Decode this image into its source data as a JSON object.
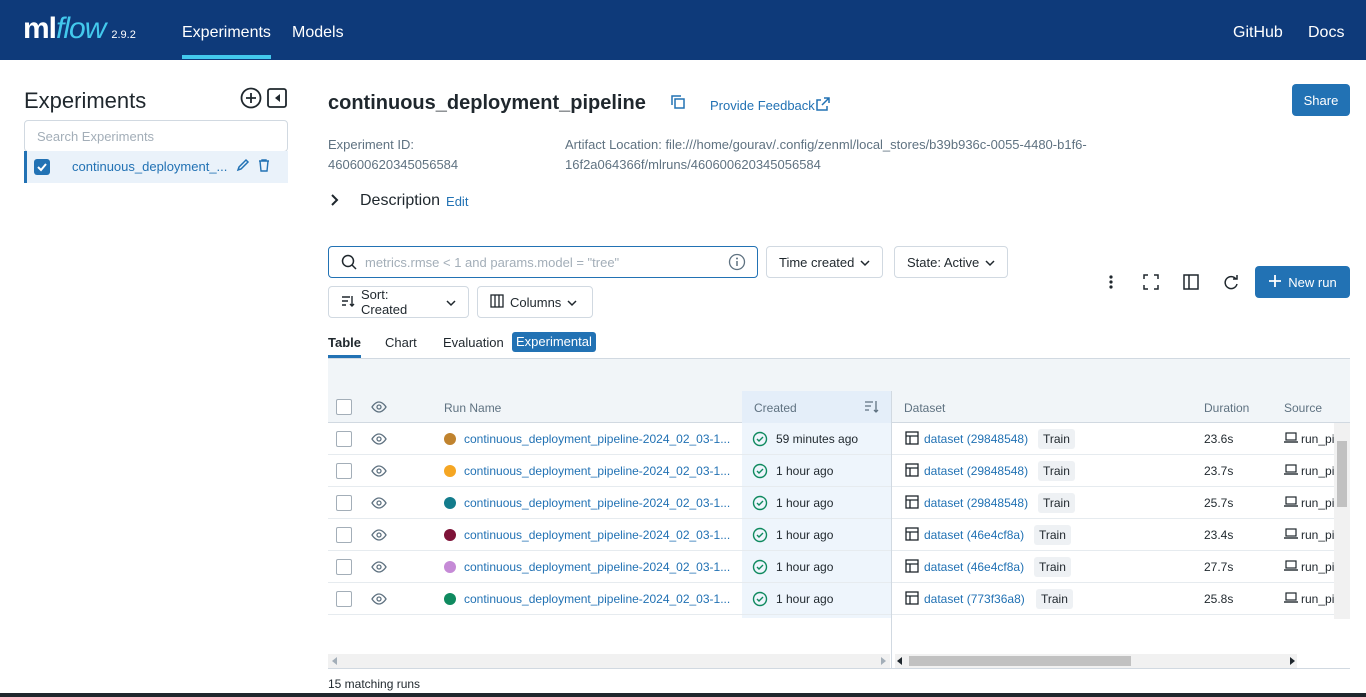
{
  "header": {
    "logo_ml": "ml",
    "logo_flow": "flow",
    "version": "2.9.2",
    "tabs": [
      {
        "label": "Experiments"
      },
      {
        "label": "Models"
      }
    ],
    "right_links": [
      {
        "label": "GitHub"
      },
      {
        "label": "Docs"
      }
    ]
  },
  "sidebar": {
    "title": "Experiments",
    "search_placeholder": "Search Experiments",
    "items": [
      {
        "label": "continuous_deployment_..."
      }
    ]
  },
  "experiment": {
    "title": "continuous_deployment_pipeline",
    "feedback_label": "Provide Feedback",
    "share_label": "Share",
    "id_label": "Experiment ID:",
    "id_value": "460600620345056584",
    "artifact_label": "Artifact Location: file:///home/gourav/.config/zenml/local_stores/b39b936c-0055-4480-b1f6-",
    "artifact_value": "16f2a064366f/mlruns/460600620345056584",
    "description_label": "Description",
    "description_edit": "Edit"
  },
  "toolbar": {
    "search_placeholder": "metrics.rmse < 1 and params.model = \"tree\"",
    "time_created": "Time created",
    "state": "State: Active",
    "sort": "Sort: Created",
    "columns": "Columns",
    "new_run": "New run"
  },
  "view_tabs": [
    {
      "label": "Table"
    },
    {
      "label": "Chart"
    },
    {
      "label": "Evaluation"
    },
    {
      "label": "Experimental"
    }
  ],
  "table": {
    "columns": [
      "Run Name",
      "Created",
      "Dataset",
      "Duration",
      "Source"
    ],
    "rows": [
      {
        "color": "#c0832e",
        "name": "continuous_deployment_pipeline-2024_02_03-1...",
        "created": "59 minutes ago",
        "dataset": "dataset (29848548)",
        "tag": "Train",
        "duration": "23.6s",
        "source": "run_pi"
      },
      {
        "color": "#f5a623",
        "name": "continuous_deployment_pipeline-2024_02_03-1...",
        "created": "1 hour ago",
        "dataset": "dataset (29848548)",
        "tag": "Train",
        "duration": "23.7s",
        "source": "run_pi"
      },
      {
        "color": "#137c8c",
        "name": "continuous_deployment_pipeline-2024_02_03-1...",
        "created": "1 hour ago",
        "dataset": "dataset (29848548)",
        "tag": "Train",
        "duration": "25.7s",
        "source": "run_pi"
      },
      {
        "color": "#7e1338",
        "name": "continuous_deployment_pipeline-2024_02_03-1...",
        "created": "1 hour ago",
        "dataset": "dataset (46e4cf8a)",
        "tag": "Train",
        "duration": "23.4s",
        "source": "run_pi"
      },
      {
        "color": "#c58ad6",
        "name": "continuous_deployment_pipeline-2024_02_03-1...",
        "created": "1 hour ago",
        "dataset": "dataset (46e4cf8a)",
        "tag": "Train",
        "duration": "27.7s",
        "source": "run_pi"
      },
      {
        "color": "#0f8a5f",
        "name": "continuous_deployment_pipeline-2024_02_03-1...",
        "created": "1 hour ago",
        "dataset": "dataset (773f36a8)",
        "tag": "Train",
        "duration": "25.8s",
        "source": "run_pi"
      }
    ]
  },
  "footer": {
    "matching": "15 matching runs"
  },
  "colors": {
    "header_bg": "#0e3a7a",
    "accent": "#2272b4",
    "logo_flow": "#43c9ed"
  }
}
